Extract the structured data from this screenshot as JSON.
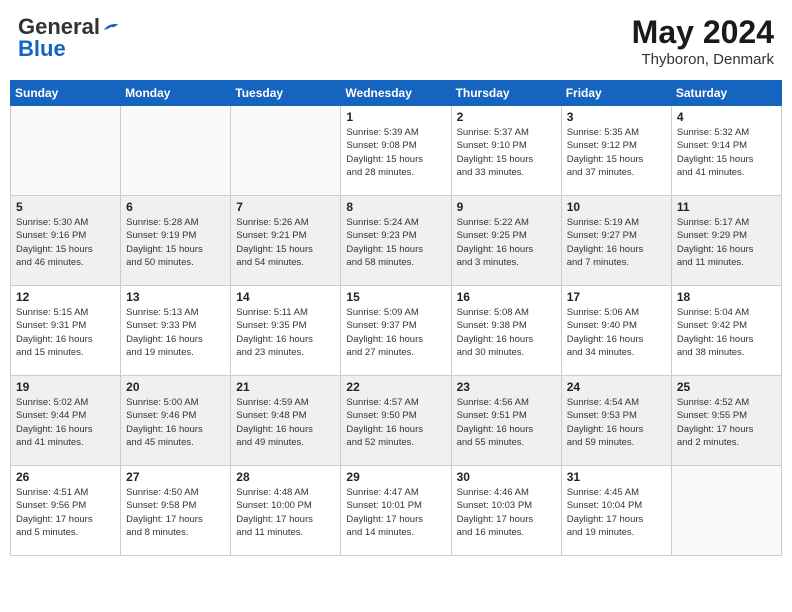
{
  "header": {
    "logo_general": "General",
    "logo_blue": "Blue",
    "title": "May 2024",
    "location": "Thyboron, Denmark"
  },
  "weekdays": [
    "Sunday",
    "Monday",
    "Tuesday",
    "Wednesday",
    "Thursday",
    "Friday",
    "Saturday"
  ],
  "weeks": [
    [
      {
        "day": "",
        "info": ""
      },
      {
        "day": "",
        "info": ""
      },
      {
        "day": "",
        "info": ""
      },
      {
        "day": "1",
        "info": "Sunrise: 5:39 AM\nSunset: 9:08 PM\nDaylight: 15 hours\nand 28 minutes."
      },
      {
        "day": "2",
        "info": "Sunrise: 5:37 AM\nSunset: 9:10 PM\nDaylight: 15 hours\nand 33 minutes."
      },
      {
        "day": "3",
        "info": "Sunrise: 5:35 AM\nSunset: 9:12 PM\nDaylight: 15 hours\nand 37 minutes."
      },
      {
        "day": "4",
        "info": "Sunrise: 5:32 AM\nSunset: 9:14 PM\nDaylight: 15 hours\nand 41 minutes."
      }
    ],
    [
      {
        "day": "5",
        "info": "Sunrise: 5:30 AM\nSunset: 9:16 PM\nDaylight: 15 hours\nand 46 minutes."
      },
      {
        "day": "6",
        "info": "Sunrise: 5:28 AM\nSunset: 9:19 PM\nDaylight: 15 hours\nand 50 minutes."
      },
      {
        "day": "7",
        "info": "Sunrise: 5:26 AM\nSunset: 9:21 PM\nDaylight: 15 hours\nand 54 minutes."
      },
      {
        "day": "8",
        "info": "Sunrise: 5:24 AM\nSunset: 9:23 PM\nDaylight: 15 hours\nand 58 minutes."
      },
      {
        "day": "9",
        "info": "Sunrise: 5:22 AM\nSunset: 9:25 PM\nDaylight: 16 hours\nand 3 minutes."
      },
      {
        "day": "10",
        "info": "Sunrise: 5:19 AM\nSunset: 9:27 PM\nDaylight: 16 hours\nand 7 minutes."
      },
      {
        "day": "11",
        "info": "Sunrise: 5:17 AM\nSunset: 9:29 PM\nDaylight: 16 hours\nand 11 minutes."
      }
    ],
    [
      {
        "day": "12",
        "info": "Sunrise: 5:15 AM\nSunset: 9:31 PM\nDaylight: 16 hours\nand 15 minutes."
      },
      {
        "day": "13",
        "info": "Sunrise: 5:13 AM\nSunset: 9:33 PM\nDaylight: 16 hours\nand 19 minutes."
      },
      {
        "day": "14",
        "info": "Sunrise: 5:11 AM\nSunset: 9:35 PM\nDaylight: 16 hours\nand 23 minutes."
      },
      {
        "day": "15",
        "info": "Sunrise: 5:09 AM\nSunset: 9:37 PM\nDaylight: 16 hours\nand 27 minutes."
      },
      {
        "day": "16",
        "info": "Sunrise: 5:08 AM\nSunset: 9:38 PM\nDaylight: 16 hours\nand 30 minutes."
      },
      {
        "day": "17",
        "info": "Sunrise: 5:06 AM\nSunset: 9:40 PM\nDaylight: 16 hours\nand 34 minutes."
      },
      {
        "day": "18",
        "info": "Sunrise: 5:04 AM\nSunset: 9:42 PM\nDaylight: 16 hours\nand 38 minutes."
      }
    ],
    [
      {
        "day": "19",
        "info": "Sunrise: 5:02 AM\nSunset: 9:44 PM\nDaylight: 16 hours\nand 41 minutes."
      },
      {
        "day": "20",
        "info": "Sunrise: 5:00 AM\nSunset: 9:46 PM\nDaylight: 16 hours\nand 45 minutes."
      },
      {
        "day": "21",
        "info": "Sunrise: 4:59 AM\nSunset: 9:48 PM\nDaylight: 16 hours\nand 49 minutes."
      },
      {
        "day": "22",
        "info": "Sunrise: 4:57 AM\nSunset: 9:50 PM\nDaylight: 16 hours\nand 52 minutes."
      },
      {
        "day": "23",
        "info": "Sunrise: 4:56 AM\nSunset: 9:51 PM\nDaylight: 16 hours\nand 55 minutes."
      },
      {
        "day": "24",
        "info": "Sunrise: 4:54 AM\nSunset: 9:53 PM\nDaylight: 16 hours\nand 59 minutes."
      },
      {
        "day": "25",
        "info": "Sunrise: 4:52 AM\nSunset: 9:55 PM\nDaylight: 17 hours\nand 2 minutes."
      }
    ],
    [
      {
        "day": "26",
        "info": "Sunrise: 4:51 AM\nSunset: 9:56 PM\nDaylight: 17 hours\nand 5 minutes."
      },
      {
        "day": "27",
        "info": "Sunrise: 4:50 AM\nSunset: 9:58 PM\nDaylight: 17 hours\nand 8 minutes."
      },
      {
        "day": "28",
        "info": "Sunrise: 4:48 AM\nSunset: 10:00 PM\nDaylight: 17 hours\nand 11 minutes."
      },
      {
        "day": "29",
        "info": "Sunrise: 4:47 AM\nSunset: 10:01 PM\nDaylight: 17 hours\nand 14 minutes."
      },
      {
        "day": "30",
        "info": "Sunrise: 4:46 AM\nSunset: 10:03 PM\nDaylight: 17 hours\nand 16 minutes."
      },
      {
        "day": "31",
        "info": "Sunrise: 4:45 AM\nSunset: 10:04 PM\nDaylight: 17 hours\nand 19 minutes."
      },
      {
        "day": "",
        "info": ""
      }
    ]
  ]
}
